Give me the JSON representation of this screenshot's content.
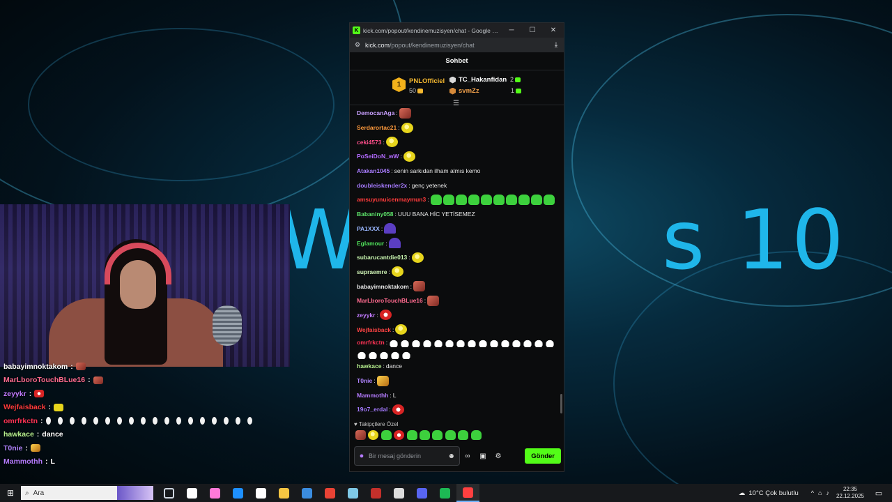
{
  "desktop": {
    "wallpaper_text": "Windows 10",
    "wallpaper_left": "Wi",
    "wallpaper_right": "s 10"
  },
  "browser": {
    "tab_title": "kick.com/popout/kendinemuzisyen/chat - Google Chr...",
    "url_host": "kick.com",
    "url_path": "/popout/kendinemuzisyen/chat",
    "logo_letter": "K"
  },
  "chat": {
    "header": "Sohbet",
    "leaderboard": {
      "first": {
        "rank": "1",
        "name": "PNLOfficiel",
        "value": "50"
      },
      "second": {
        "name": "TC_Hakanfidan",
        "value": "2"
      },
      "third": {
        "name": "svmZz",
        "value": "1"
      }
    },
    "messages": [
      {
        "user": "DemocanAga",
        "color": "#c9a0ff",
        "text": "",
        "emotes": [
          "face"
        ]
      },
      {
        "user": "Serdarortac21",
        "color": "#ff9a3c",
        "text": "",
        "emotes": [
          "pepe"
        ]
      },
      {
        "user": "ceki4573",
        "color": "#ff4f8b",
        "text": "",
        "emotes": [
          "pepe"
        ]
      },
      {
        "user": "PoSeiDoN_wW",
        "color": "#b36bff",
        "text": "",
        "emotes": [
          "pepe"
        ]
      },
      {
        "user": "Atakan1045",
        "color": "#a97cff",
        "text": "senin sarkıdan ilham almıs kemo",
        "emotes": []
      },
      {
        "user": "doubleiskender2x",
        "color": "#a77bff",
        "text": "genç yetenek",
        "emotes": []
      },
      {
        "user": "amsuyunuicenmaymun3",
        "color": "#ff3b3b",
        "text": "",
        "emotes": [
          "green",
          "green",
          "green",
          "green",
          "green",
          "green",
          "green",
          "green",
          "green",
          "green"
        ]
      },
      {
        "user": "Babaniny058",
        "color": "#5de26a",
        "text": "UUU BANA HİC YETİSEMEZ",
        "emotes": []
      },
      {
        "user": "PA1XXX",
        "color": "#9ab7ff",
        "text": "",
        "emotes": [
          "purple"
        ]
      },
      {
        "user": "Eglamour",
        "color": "#4fe05a",
        "text": "",
        "emotes": [
          "purple"
        ]
      },
      {
        "user": "subarucantdie013",
        "color": "#c9f7b0",
        "text": "",
        "emotes": [
          "pepe"
        ]
      },
      {
        "user": "supraemre",
        "color": "#d2f6b8",
        "text": "",
        "emotes": [
          "pepe"
        ]
      },
      {
        "user": "babayimnoktakom",
        "color": "#e8e8e8",
        "text": "",
        "emotes": [
          "face"
        ]
      },
      {
        "user": "MarLboroTouchBLue16",
        "color": "#ff6b8f",
        "text": "",
        "emotes": [
          "face"
        ]
      },
      {
        "user": "zeyykr",
        "color": "#c27bff",
        "text": "",
        "emotes": [
          "red"
        ]
      },
      {
        "user": "Wejfaisback",
        "color": "#ff4444",
        "text": "",
        "emotes": [
          "pepe"
        ]
      },
      {
        "user": "omrfrkctn",
        "color": "#ff3355",
        "text": "",
        "emotes": [
          "duck",
          "duck",
          "duck",
          "duck",
          "duck",
          "duck",
          "duck",
          "duck",
          "duck",
          "duck",
          "duck",
          "duck",
          "duck",
          "duck",
          "duck",
          "duck",
          "duck",
          "duck",
          "duck",
          "duck"
        ]
      },
      {
        "user": "hawkace",
        "color": "#b7f08f",
        "text": "dance",
        "emotes": []
      },
      {
        "user": "T0nie",
        "color": "#b084ff",
        "text": "",
        "emotes": [
          "gold"
        ]
      },
      {
        "user": "Mammothh",
        "color": "#b57cff",
        "text": "L",
        "emotes": []
      },
      {
        "user": "19o7_erdal",
        "color": "#a57aff",
        "text": "",
        "emotes": [
          "red"
        ]
      }
    ],
    "followers_label": "♥ Takipçilere Özel",
    "quick_emotes": [
      "face",
      "pepe",
      "green",
      "red",
      "green",
      "green",
      "green",
      "green",
      "green",
      "green"
    ],
    "input_placeholder": "Bir mesaj gönderin",
    "send_label": "Gönder"
  },
  "overlay": {
    "lines": [
      {
        "user": "babayimnoktakom",
        "color": "#ffffff",
        "text": "",
        "emote": "face"
      },
      {
        "user": "MarLboroTouchBLue16",
        "color": "#ff6b8f",
        "text": "",
        "emote": "face"
      },
      {
        "user": "zeyykr",
        "color": "#c27bff",
        "text": "",
        "emote": "red"
      },
      {
        "user": "Wejfaisback",
        "color": "#ff3b3b",
        "text": "",
        "emote": "pepe"
      },
      {
        "user": "omrfrkctn",
        "color": "#ff3355",
        "text": "",
        "emote": "duck"
      },
      {
        "user": "hawkace",
        "color": "#b7f08f",
        "text": "dance",
        "emote": ""
      },
      {
        "user": "T0nie",
        "color": "#b084ff",
        "text": "",
        "emote": "gold"
      },
      {
        "user": "Mammothh",
        "color": "#b57cff",
        "text": "L",
        "emote": ""
      }
    ]
  },
  "taskbar": {
    "search_placeholder": "Ara",
    "weather": "10°C  Çok bulutlu",
    "time": "22:35",
    "date": "22.12.2025",
    "apps": [
      "#6fa8ff",
      "#ffffff",
      "#ff7ad9",
      "#1e90ff",
      "#ffffff",
      "#f5c542",
      "#3b8de0",
      "#ea4335",
      "#7fc8e6",
      "#c4302b",
      "#dddddd",
      "#5865f2",
      "#1db954",
      "#ff4040"
    ]
  }
}
